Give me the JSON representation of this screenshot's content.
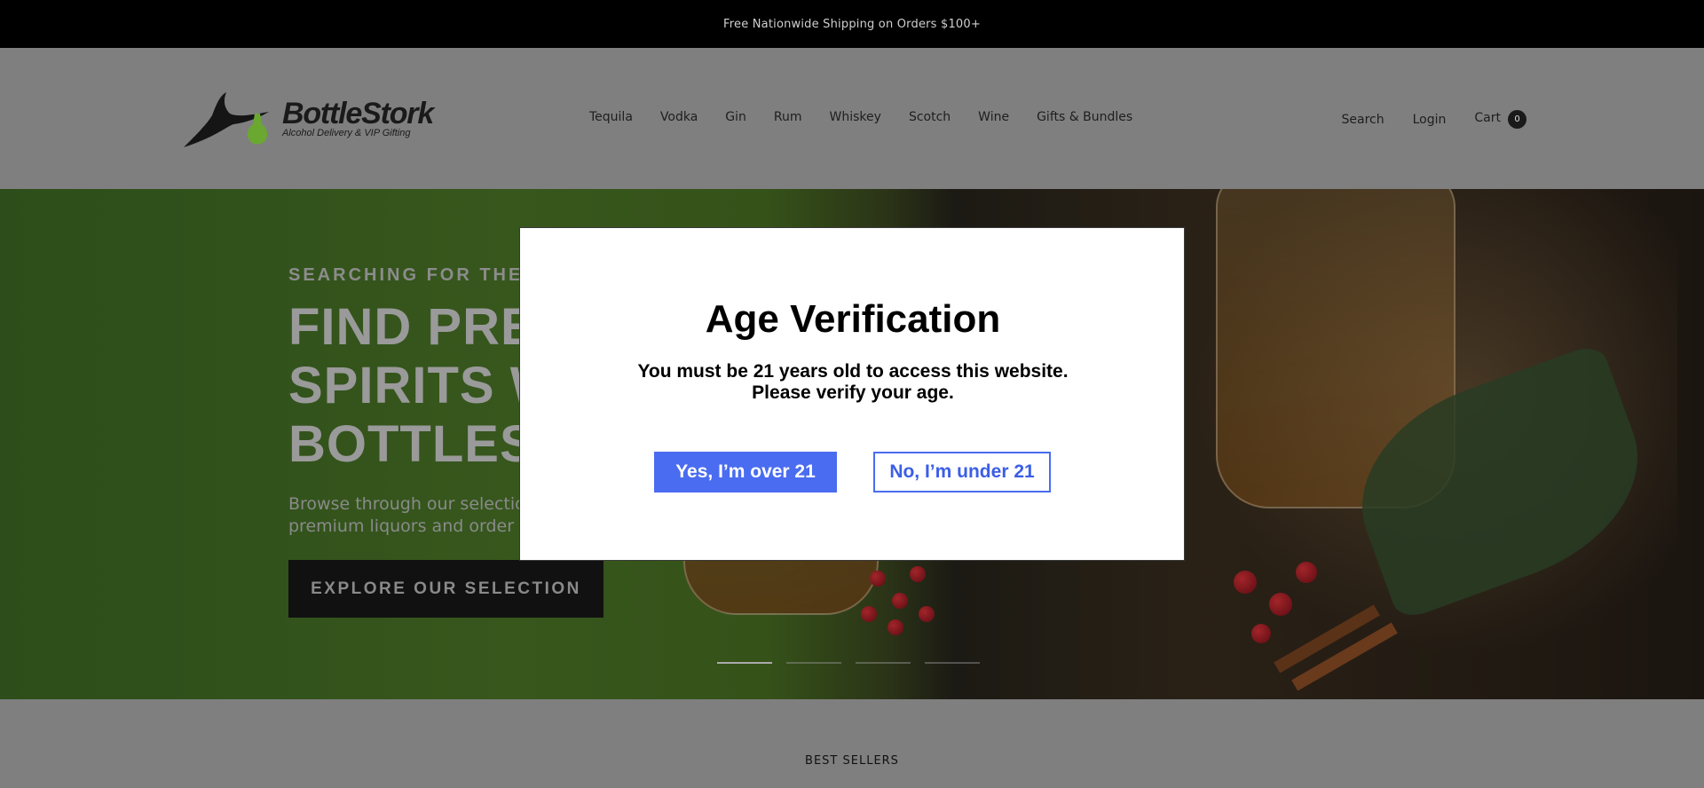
{
  "announcement": {
    "text": "Free Nationwide Shipping on Orders $100+"
  },
  "header": {
    "logo": {
      "name": "BottleStork",
      "tagline": "Alcohol Delivery & VIP Gifting",
      "icon": "stork-bottle-logo"
    },
    "nav": [
      {
        "label": "Tequila"
      },
      {
        "label": "Vodka"
      },
      {
        "label": "Gin"
      },
      {
        "label": "Rum"
      },
      {
        "label": "Whiskey"
      },
      {
        "label": "Scotch"
      },
      {
        "label": "Wine"
      },
      {
        "label": "Gifts & Bundles"
      }
    ],
    "secondary": {
      "search": "Search",
      "login": "Login",
      "cart": "Cart",
      "cart_count": "0"
    }
  },
  "hero": {
    "eyebrow": "SEARCHING FOR THE R",
    "title_lines": [
      "FIND PRE",
      "SPIRITS W",
      "BOTTLES"
    ],
    "subtitle_lines": [
      "Browse through our selectio",
      "premium liquors and order w"
    ],
    "cta": "EXPLORE OUR SELECTION",
    "slides": 4,
    "active_slide": 1
  },
  "best_sellers": {
    "title": "BEST SELLERS"
  },
  "modal": {
    "title": "Age Verification",
    "message_line1": "You must be 21 years old to access this website.",
    "message_line2": "Please verify your age.",
    "yes": "Yes, I’m over 21",
    "no": "No, I’m under 21"
  },
  "colors": {
    "primary_button": "#4a6cf0",
    "announcement_bg": "#000000",
    "overlay": "#7f7f7f"
  }
}
